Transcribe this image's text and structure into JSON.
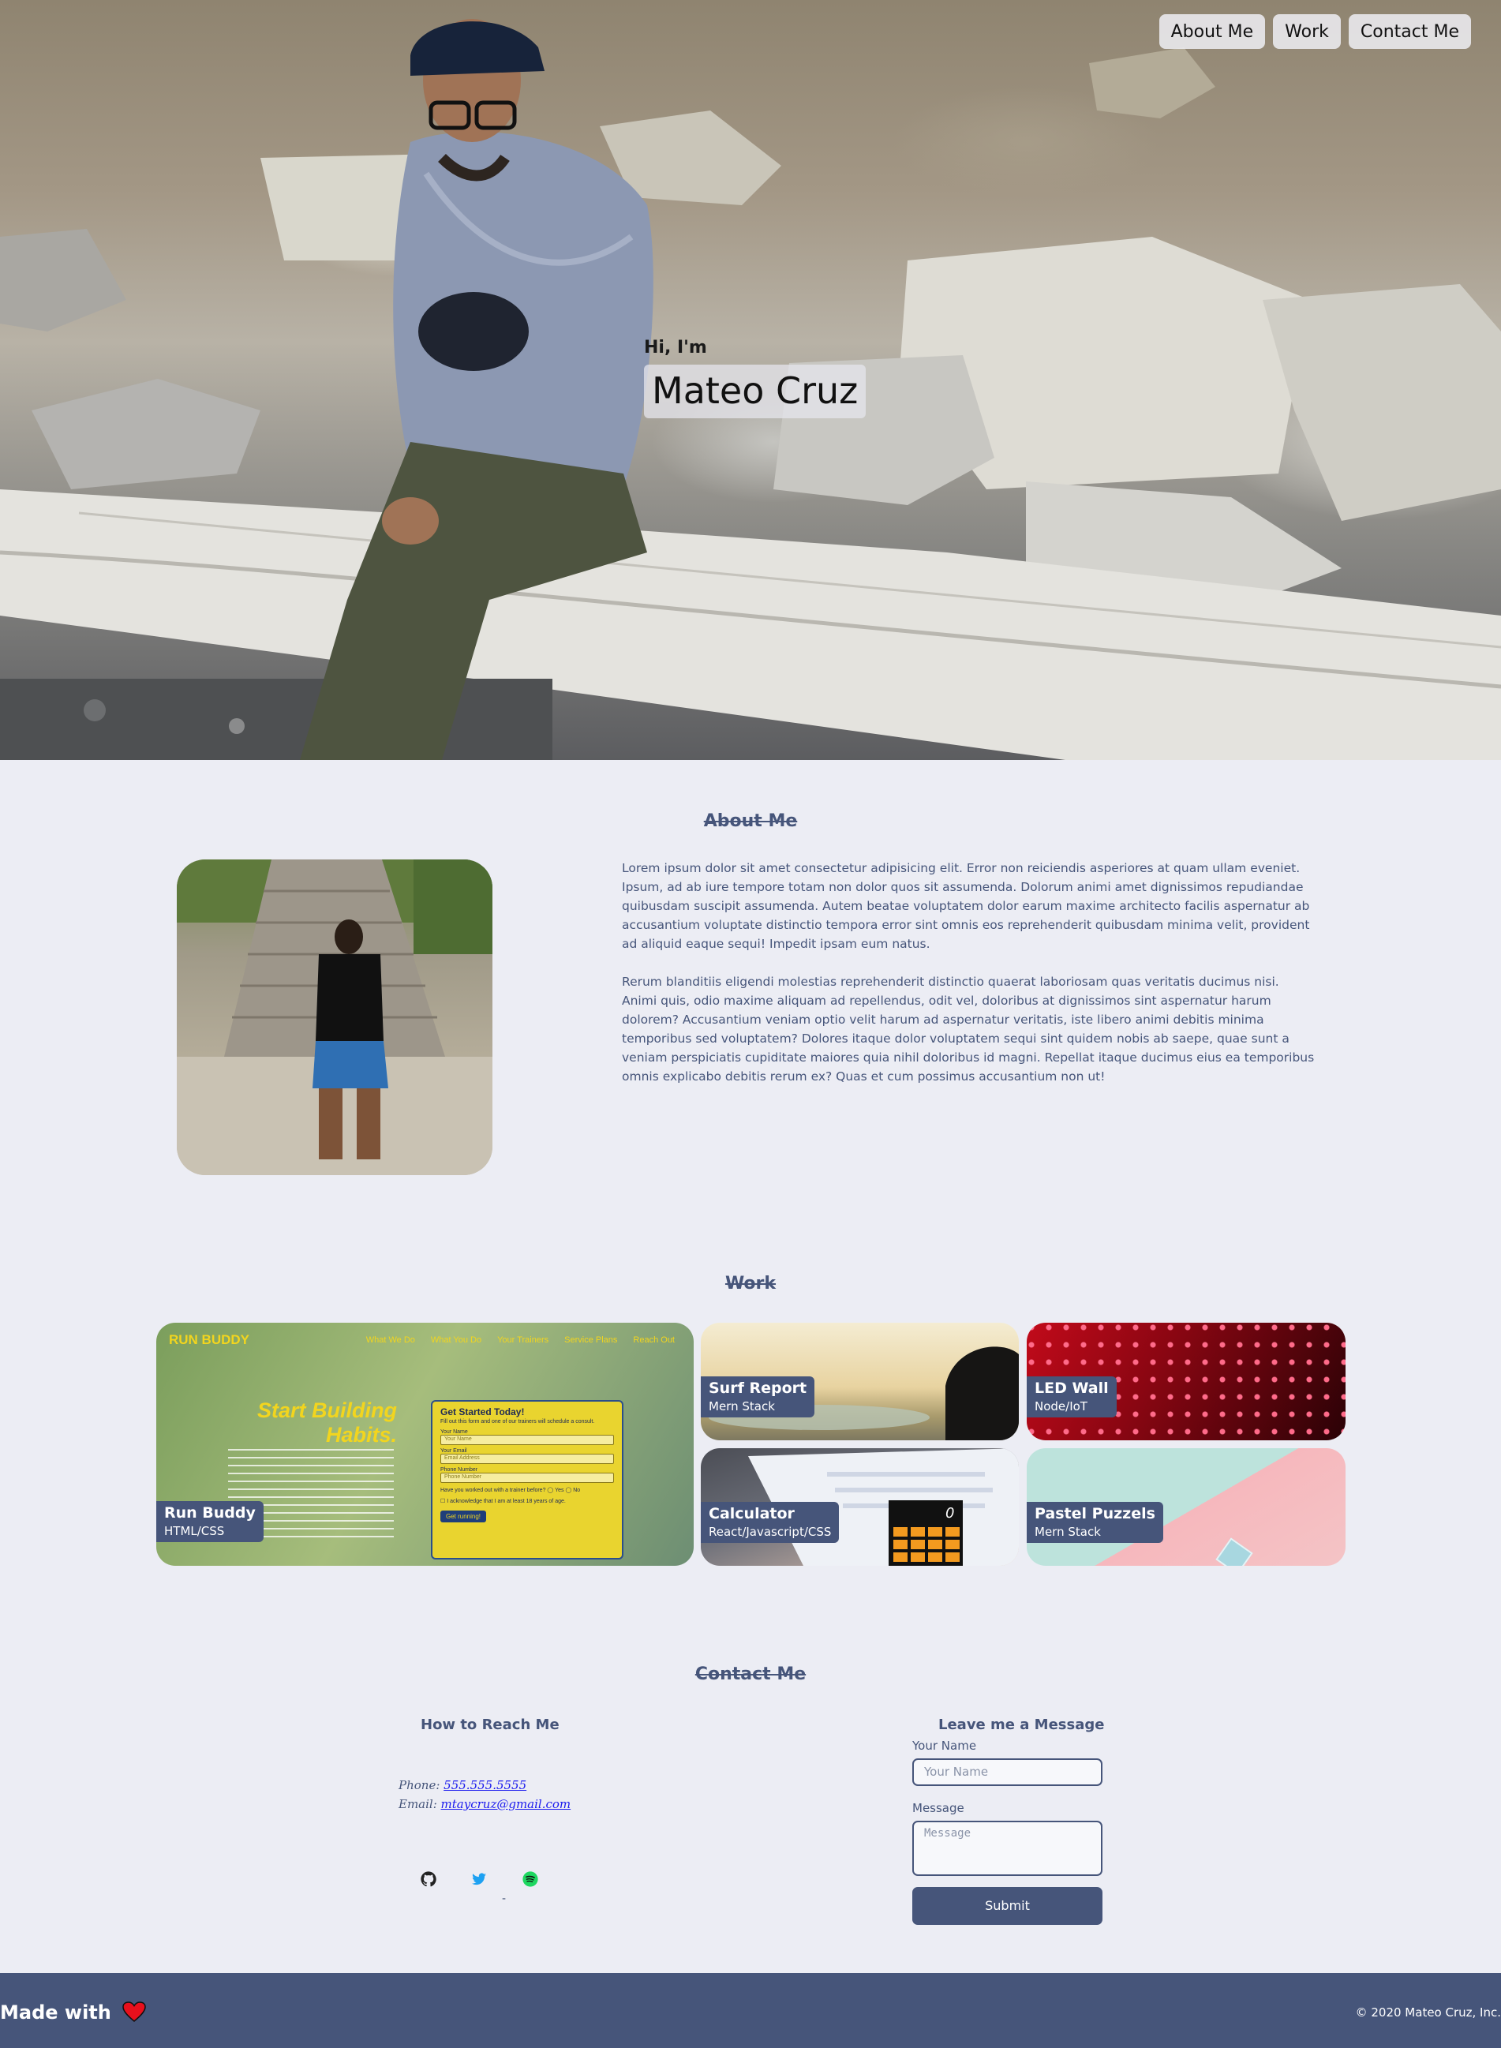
{
  "nav": {
    "items": [
      {
        "label": "About Me"
      },
      {
        "label": "Work"
      },
      {
        "label": "Contact Me"
      }
    ]
  },
  "hero": {
    "intro": "Hi, I'm",
    "name": "Mateo Cruz"
  },
  "about": {
    "title": "About Me",
    "paragraphs": [
      "Lorem ipsum dolor sit amet consectetur adipisicing elit. Error non reiciendis asperiores at quam ullam eveniet. Ipsum, ad ab iure tempore totam non dolor quos sit assumenda. Dolorum animi amet dignissimos repudiandae quibusdam suscipit assumenda. Autem beatae voluptatem dolor earum maxime architecto facilis aspernatur ab accusantium voluptate distinctio tempora error sint omnis eos reprehenderit quibusdam minima velit, provident ad aliquid eaque sequi! Impedit ipsam eum natus.",
      "Rerum blanditiis eligendi molestias reprehenderit distinctio quaerat laboriosam quas veritatis ducimus nisi. Animi quis, odio maxime aliquam ad repellendus, odit vel, doloribus at dignissimos sint aspernatur harum dolorem? Accusantium veniam optio velit harum ad aspernatur veritatis, iste libero animi debitis minima temporibus sed voluptatem? Dolores itaque dolor voluptatem sequi sint quidem nobis ab saepe, quae sunt a veniam perspiciatis cupiditate maiores quia nihil doloribus id magni. Repellat itaque ducimus eius ea temporibus omnis explicabo debitis rerum ex? Quas et cum possimus accusantium non ut!"
    ]
  },
  "work": {
    "title": "Work",
    "projects": [
      {
        "title": "Run Buddy",
        "stack": "HTML/CSS"
      },
      {
        "title": "Surf Report",
        "stack": "Mern Stack"
      },
      {
        "title": "LED Wall",
        "stack": "Node/IoT"
      },
      {
        "title": "Calculator",
        "stack": "React/Javascript/CSS"
      },
      {
        "title": "Pastel Puzzels",
        "stack": "Mern Stack"
      }
    ],
    "run_buddy_preview": {
      "brand": "RUN BUDDY",
      "nav": [
        "What We Do",
        "What You Do",
        "Your Trainers",
        "Service Plans",
        "Reach Out"
      ],
      "headline_1": "Start Building",
      "headline_2": "Habits.",
      "form_title": "Get Started Today!",
      "form_sub": "Fill out this form and one of our trainers will schedule a consult.",
      "name_label": "Your Name",
      "name_placeholder": "Your Name",
      "email_label": "Your Email",
      "email_placeholder": "Email Address",
      "phone_label": "Phone Number",
      "phone_placeholder": "Phone Number",
      "question": "Have you worked out with a trainer before?",
      "yes": "Yes",
      "no": "No",
      "ack": "I acknowledge that I am at least 18 years of age.",
      "cta": "Get running!"
    },
    "calculator_display": "0"
  },
  "contact": {
    "title": "Contact Me",
    "reach_title": "How to Reach Me",
    "phone_label": "Phone:",
    "phone": "555.555.5555",
    "email_label": "Email:",
    "email": "mtaycruz@gmail.com",
    "divider": "-",
    "message_title": "Leave me a Message",
    "name_label": "Your Name",
    "name_placeholder": "Your Name",
    "message_label": "Message",
    "message_placeholder": "Message",
    "submit_label": "Submit"
  },
  "footer": {
    "made_with": "Made with",
    "copyright": "© 2020 Mateo Cruz, Inc."
  },
  "colors": {
    "accent": "#46557a",
    "background": "#ecedf4",
    "heart": "#e8101c",
    "twitter": "#1da1f2",
    "spotify": "#1ed760"
  },
  "icons": [
    "github-icon",
    "twitter-icon",
    "spotify-icon",
    "heart-icon"
  ]
}
